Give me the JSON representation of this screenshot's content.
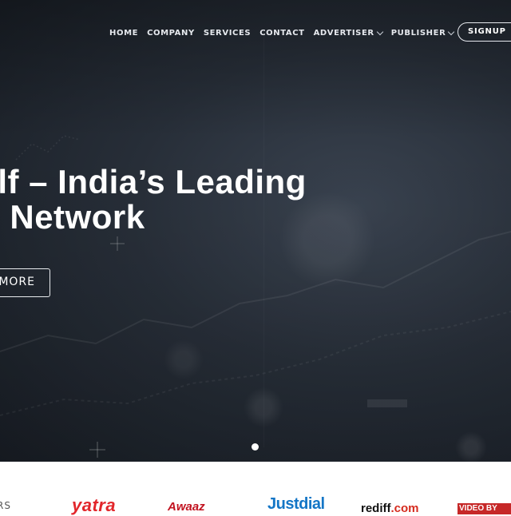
{
  "nav": {
    "items": [
      {
        "label": "HOME",
        "dropdown": false
      },
      {
        "label": "COMPANY",
        "dropdown": false
      },
      {
        "label": "SERVICES",
        "dropdown": false
      },
      {
        "label": "CONTACT",
        "dropdown": false
      },
      {
        "label": "ADVERTISER",
        "dropdown": true
      },
      {
        "label": "PUBLISHER",
        "dropdown": true
      }
    ],
    "signup_label": "SIGNUP"
  },
  "hero": {
    "headline_line1": "wolf – India’s Leading",
    "headline_line2": "ate Network",
    "button_label": "MORE",
    "slides_total": 1,
    "active_slide": 1
  },
  "partners": {
    "label": "RS",
    "logos": [
      {
        "name": "yatra",
        "text": "yatra"
      },
      {
        "name": "script-logo",
        "text": "Awaaz"
      },
      {
        "name": "justdial",
        "text": "Justdial"
      },
      {
        "name": "rediff",
        "text": "rediff",
        "suffix": ".com"
      },
      {
        "name": "video-box",
        "text": "VIDEO BY"
      }
    ]
  },
  "colors": {
    "hero_bg": "#272e38",
    "text_light": "#ffffff",
    "yatra_red": "#e2262b",
    "justdial_blue": "#1476c6",
    "rediff_red": "#d52b1e"
  }
}
